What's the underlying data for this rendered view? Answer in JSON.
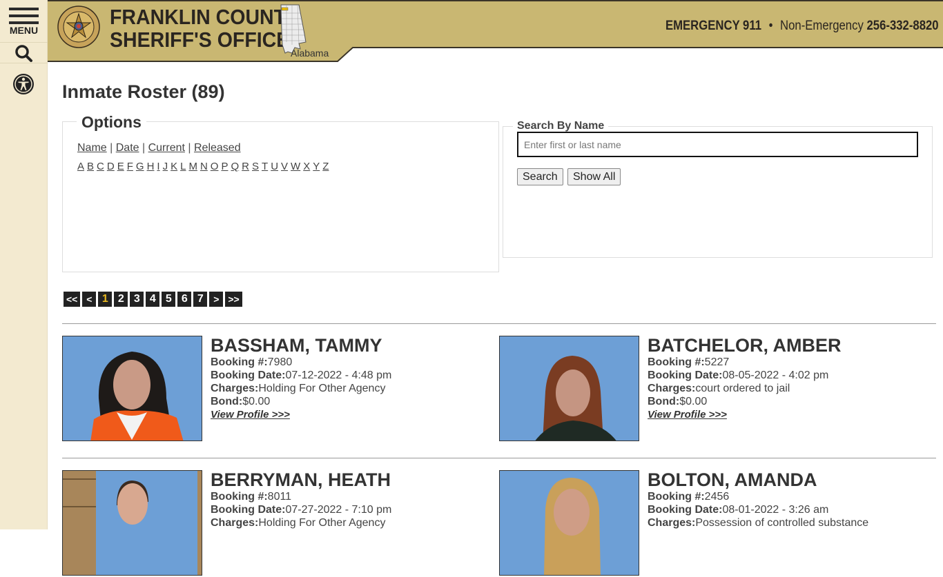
{
  "sidebar": {
    "menu_label": "MENU",
    "icons": [
      "hamburger-icon",
      "search-icon",
      "accessibility-icon"
    ]
  },
  "header": {
    "title_line1": "FRANKLIN COUNTY",
    "title_line2": "SHERIFF'S OFFICE",
    "state_label": "Alabama",
    "emergency_label": "EMERGENCY 911",
    "separator": "•",
    "non_emergency_label": "Non-Emergency",
    "non_emergency_phone": "256-332-8820",
    "colors": {
      "brand_tan": "#c9b772",
      "dark": "#2a2520",
      "sidebar_cream": "#f3ead0"
    }
  },
  "page": {
    "title": "Inmate Roster (89)"
  },
  "options": {
    "legend": "Options",
    "sort_links": [
      "Name",
      "Date",
      "Current",
      "Released"
    ],
    "alphabet": [
      "A",
      "B",
      "C",
      "D",
      "E",
      "F",
      "G",
      "H",
      "I",
      "J",
      "K",
      "L",
      "M",
      "N",
      "O",
      "P",
      "Q",
      "R",
      "S",
      "T",
      "U",
      "V",
      "W",
      "X",
      "Y",
      "Z"
    ]
  },
  "search": {
    "legend": "Search By Name",
    "placeholder": "Enter first or last name",
    "value": "",
    "search_label": "Search",
    "show_all_label": "Show All"
  },
  "pagination": {
    "first": "<<",
    "prev": "<",
    "pages": [
      "1",
      "2",
      "3",
      "4",
      "5",
      "6",
      "7"
    ],
    "current": "1",
    "next": ">",
    "last": ">>",
    "active_color": "#e8b820"
  },
  "inmates": [
    {
      "name": "BASSHAM, TAMMY",
      "booking_no_label": "Booking #:",
      "booking_no": "7980",
      "booking_date_label": "Booking Date:",
      "booking_date": "07-12-2022 - 4:48 pm",
      "charges_label": "Charges:",
      "charges": "Holding For Other Agency",
      "bond_label": "Bond:",
      "bond": "$0.00",
      "view_label": "View Profile >>>"
    },
    {
      "name": "BATCHELOR, AMBER",
      "booking_no_label": "Booking #:",
      "booking_no": "5227",
      "booking_date_label": "Booking Date:",
      "booking_date": "08-05-2022 - 4:02 pm",
      "charges_label": "Charges:",
      "charges": "court ordered to jail",
      "bond_label": "Bond:",
      "bond": "$0.00",
      "view_label": "View Profile >>>"
    },
    {
      "name": "BERRYMAN, HEATH",
      "booking_no_label": "Booking #:",
      "booking_no": "8011",
      "booking_date_label": "Booking Date:",
      "booking_date": "07-27-2022 - 7:10 pm",
      "charges_label": "Charges:",
      "charges": "Holding For Other Agency"
    },
    {
      "name": "BOLTON, AMANDA",
      "booking_no_label": "Booking #:",
      "booking_no": "2456",
      "booking_date_label": "Booking Date:",
      "booking_date": "08-01-2022 - 3:26 am",
      "charges_label": "Charges:",
      "charges": "Possession of controlled substance"
    }
  ]
}
